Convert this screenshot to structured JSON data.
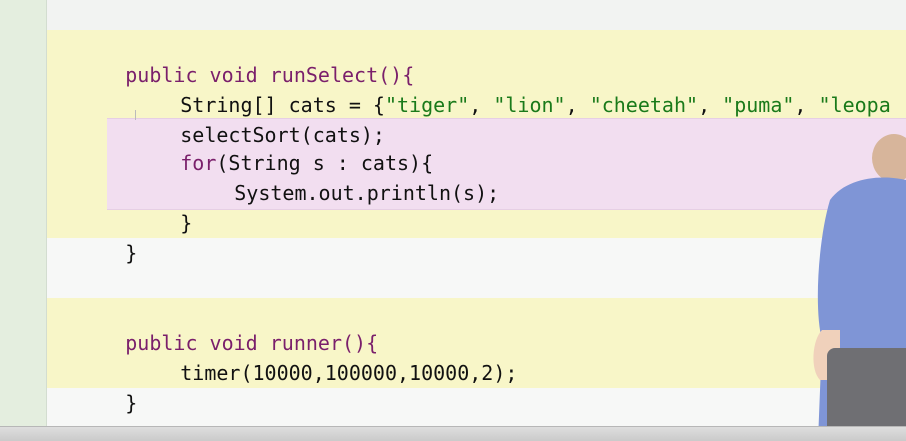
{
  "code": {
    "lines": [
      [
        "public void runSelect(){"
      ],
      [
        "String[] cats = {",
        "\"tiger\"",
        ", ",
        "\"lion\"",
        ", ",
        "\"cheetah\"",
        ", ",
        "\"puma\"",
        ", ",
        "\"leopa"
      ],
      [
        "selectSort(cats);"
      ],
      [
        "for",
        "(String s : cats){"
      ],
      [
        "System.out.println(s);"
      ],
      [
        "}"
      ],
      [
        "}"
      ],
      [
        "public void runner(){"
      ],
      [
        "timer(10000,100000,10000,2);"
      ],
      [
        "}"
      ]
    ]
  },
  "colors": {
    "keyword": "#7a1f6b",
    "string": "#1a7a1a",
    "highlight_yellow": "#f8f6c8",
    "highlight_pink": "#f2def0"
  }
}
